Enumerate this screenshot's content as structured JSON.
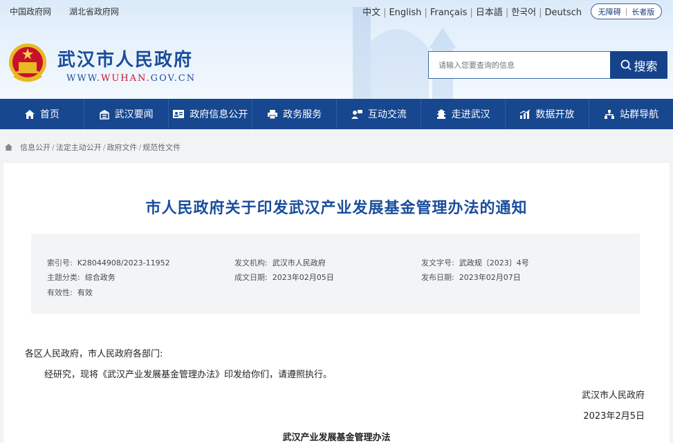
{
  "top_links": [
    "中国政府网",
    "湖北省政府网"
  ],
  "languages": [
    "中文",
    "English",
    "Français",
    "日本語",
    "한국어",
    "Deutsch"
  ],
  "accessibility": {
    "barrier_free": "无障碍",
    "elder": "长者版"
  },
  "site": {
    "title": "武汉市人民政府",
    "url_prefix": "WWW.",
    "url_highlight": "WUHAN",
    "url_suffix": ".GOV.CN"
  },
  "search": {
    "placeholder": "请输入您要查询的信息",
    "button": "搜索"
  },
  "nav": [
    {
      "label": "首页",
      "icon": "home-icon"
    },
    {
      "label": "武汉要闻",
      "icon": "building-icon"
    },
    {
      "label": "政府信息公开",
      "icon": "id-card-icon"
    },
    {
      "label": "政务服务",
      "icon": "printer-icon"
    },
    {
      "label": "互动交流",
      "icon": "chat-users-icon"
    },
    {
      "label": "走进武汉",
      "icon": "pagoda-icon"
    },
    {
      "label": "数据开放",
      "icon": "chart-icon"
    },
    {
      "label": "站群导航",
      "icon": "sitemap-icon"
    }
  ],
  "breadcrumb": [
    "信息公开",
    "法定主动公开",
    "政府文件",
    "规范性文件"
  ],
  "document": {
    "title": "市人民政府关于印发武汉产业发展基金管理办法的通知",
    "meta": {
      "index_label": "索引号:",
      "index_value": "K28044908/2023-11952",
      "org_label": "发文机构:",
      "org_value": "武汉市人民政府",
      "docno_label": "发文字号:",
      "docno_value": "武政规〔2023〕4号",
      "topic_label": "主题分类:",
      "topic_value": "综合政务",
      "created_label": "成文日期:",
      "created_value": "2023年02月05日",
      "published_label": "发布日期:",
      "published_value": "2023年02月07日",
      "validity_label": "有效性:",
      "validity_value": "有效"
    },
    "salutation": "各区人民政府，市人民政府各部门:",
    "body": "经研究，现将《武汉产业发展基金管理办法》印发给你们，请遵照执行。",
    "signature": "武汉市人民政府",
    "date": "2023年2月5日",
    "attachment_title": "武汉产业发展基金管理办法"
  },
  "colors": {
    "brand": "#1a4d9c",
    "nav_bg": "#17478f",
    "search_btn": "#16428a"
  }
}
